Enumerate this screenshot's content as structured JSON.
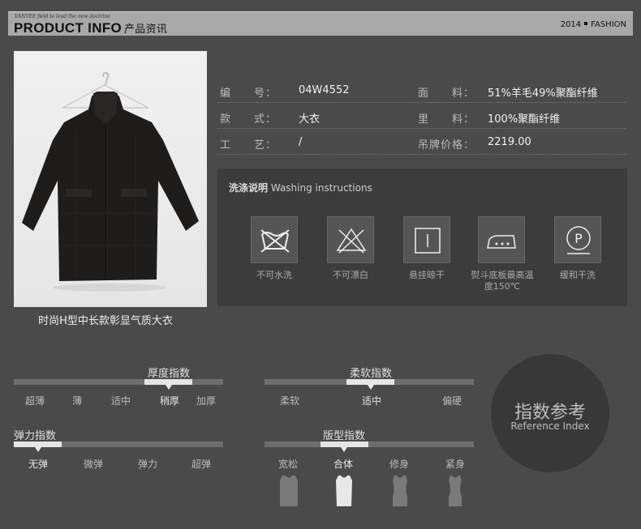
{
  "header": {
    "tagline": "VANYEE field to lead the new doctrine",
    "title": "PRODUCT INFO",
    "title_cn": "产品资讯",
    "year": "2014",
    "fashion": "FASHION"
  },
  "product": {
    "caption": "时尚H型中长款彰显气质大衣"
  },
  "specs": [
    {
      "label_a": "编　　号：",
      "value_a": "04W4552",
      "label_b": "面　　料：",
      "value_b": "51%羊毛49%聚酯纤维"
    },
    {
      "label_a": "款　　式：",
      "value_a": "大衣",
      "label_b": "里　　料：",
      "value_b": "100%聚酯纤维"
    },
    {
      "label_a": "工　　艺：",
      "value_a": "/",
      "label_b": "吊牌价格：",
      "value_b": "2219.00"
    }
  ],
  "washing": {
    "title_cn": "洗涤说明",
    "title_en": "Washing instructions",
    "items": [
      {
        "icon": "no-wash-icon",
        "label": "不可水洗"
      },
      {
        "icon": "no-bleach-icon",
        "label": "不可漂白"
      },
      {
        "icon": "hang-dry-icon",
        "label": "悬挂晾干"
      },
      {
        "icon": "iron-icon",
        "label": "熨斗底板最高温度150℃"
      },
      {
        "icon": "gentle-dry-clean-icon",
        "label": "缓和干洗"
      }
    ]
  },
  "indices": {
    "thickness": {
      "title": "厚度指数",
      "levels": [
        "超薄",
        "薄",
        "适中",
        "稍厚",
        "加厚"
      ],
      "selected": 3
    },
    "softness": {
      "title": "柔软指数",
      "levels": [
        "柔软",
        "适中",
        "偏硬"
      ],
      "selected": 1
    },
    "elasticity": {
      "title": "弹力指数",
      "levels": [
        "无弹",
        "微弹",
        "弹力",
        "超弹"
      ],
      "selected": 0
    },
    "fit": {
      "title": "版型指数",
      "levels": [
        "宽松",
        "合体",
        "修身",
        "紧身"
      ],
      "selected": 1
    }
  },
  "reference": {
    "cn": "指数参考",
    "en": "Reference Index"
  },
  "colors": {
    "background": "#4a4a4a",
    "highlight": "#e6e6e6",
    "track": "#6e6e6e"
  }
}
